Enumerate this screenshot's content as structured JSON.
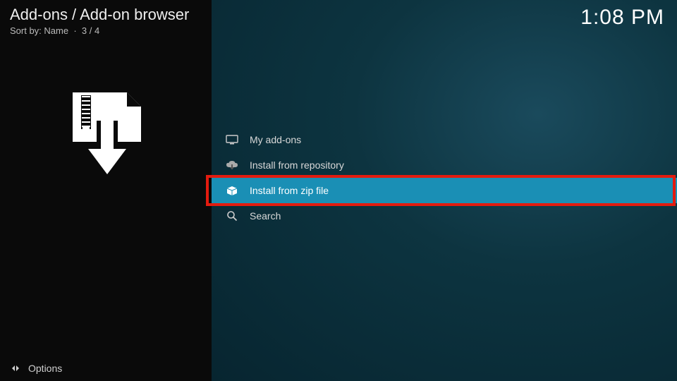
{
  "header": {
    "breadcrumb": "Add-ons / Add-on browser",
    "sort_label": "Sort by: Name",
    "position": "3 / 4"
  },
  "clock": "1:08 PM",
  "menu": {
    "items": [
      {
        "label": "My add-ons",
        "icon": "monitor-icon"
      },
      {
        "label": "Install from repository",
        "icon": "cloud-download-icon"
      },
      {
        "label": "Install from zip file",
        "icon": "box-open-icon"
      },
      {
        "label": "Search",
        "icon": "search-icon"
      }
    ],
    "selected_index": 2,
    "highlighted_index": 2
  },
  "footer": {
    "options_label": "Options"
  }
}
